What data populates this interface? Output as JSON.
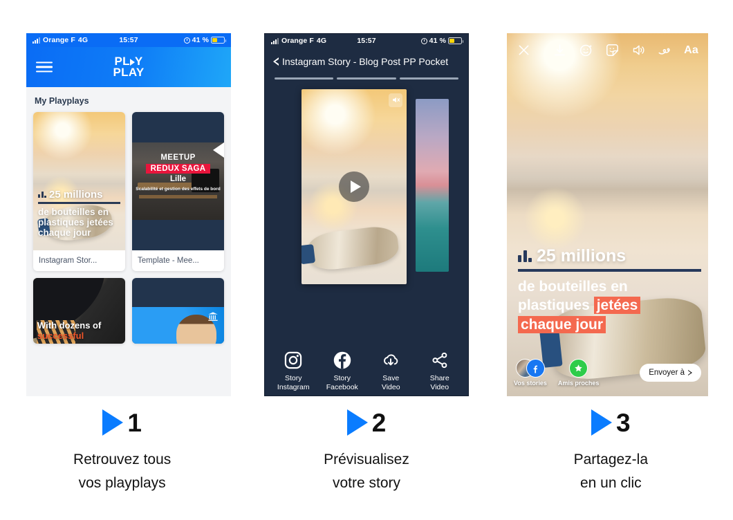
{
  "status_bar": {
    "carrier": "Orange F",
    "network": "4G",
    "time": "15:57",
    "battery_text": "41 %",
    "battery_percent": 41,
    "signal_icon": "signal-bars-icon",
    "alarm_icon": "alarm-clock-icon",
    "battery_icon": "battery-icon"
  },
  "phone1": {
    "menu_icon": "hamburger-menu-icon",
    "logo_line1": "PL",
    "logo_line1b": "Y",
    "logo_line2": "PLAY",
    "logo_play_icon": "play-triangle-icon",
    "section_title": "My Playplays",
    "cards": [
      {
        "label": "Instagram Stor...",
        "overlay_head": "25 millions",
        "overlay_sub": "de bouteilles en plastiques jetées chaque jour",
        "chart_icon": "bar-chart-icon"
      },
      {
        "label": "Template - Mee...",
        "t1": "MEETUP",
        "t2": "REDUX SAGA",
        "t3": "Lille",
        "t4": "Scalabilité et gestion des effets de bord"
      },
      {
        "overlay_l1": "With dozens of",
        "overlay_l2": "successful"
      },
      {
        "badge_icon": "unesco-bank-icon"
      }
    ]
  },
  "phone2": {
    "back_icon": "chevron-left-icon",
    "title": "Instagram Story - Blog Post PP Pocket",
    "segments": 3,
    "mute_icon": "speaker-muted-icon",
    "play_icon": "play-button-icon",
    "actions": [
      {
        "icon": "instagram-icon",
        "line1": "Story",
        "line2": "Instagram"
      },
      {
        "icon": "facebook-icon",
        "line1": "Story",
        "line2": "Facebook"
      },
      {
        "icon": "cloud-download-icon",
        "line1": "Save",
        "line2": "Video"
      },
      {
        "icon": "share-nodes-icon",
        "line1": "Share",
        "line2": "Video"
      }
    ]
  },
  "phone3": {
    "toolbar": [
      {
        "icon": "close-x-icon",
        "label": ""
      },
      {
        "icon": "download-icon",
        "label": ""
      },
      {
        "icon": "smiley-sparkle-icon",
        "label": ""
      },
      {
        "icon": "sticker-icon",
        "label": ""
      },
      {
        "icon": "volume-icon",
        "label": ""
      },
      {
        "icon": "squiggle-draw-icon",
        "label": ""
      },
      {
        "icon": "text-aa-icon",
        "label": "Aa"
      }
    ],
    "overlay_head": "25 millions",
    "overlay_line1": "de bouteilles en",
    "overlay_line2a": "plastiques ",
    "overlay_line2b": "jetées",
    "overlay_line3": "chaque jour",
    "chart_icon": "bar-chart-icon",
    "share_targets": [
      {
        "label": "Vos stories",
        "icon": "avatar-facebook-icon"
      },
      {
        "label": "Amis proches",
        "icon": "close-friends-star-icon"
      }
    ],
    "send_button": "Envoyer à",
    "send_chevron_icon": "chevron-right-icon"
  },
  "captions": [
    {
      "number": "1",
      "play_icon": "play-triangle-icon",
      "line1": "Retrouvez tous",
      "line2": "vos playplays"
    },
    {
      "number": "2",
      "play_icon": "play-triangle-icon",
      "line1": "Prévisualisez",
      "line2": "votre story"
    },
    {
      "number": "3",
      "play_icon": "play-triangle-icon",
      "line1": "Partagez-la",
      "line2": "en un clic"
    }
  ],
  "colors": {
    "brand_blue": "#0a6cf5",
    "accent_blue": "#0a7cff",
    "dark_navy": "#1e2c42",
    "coral": "#f4694f",
    "red_badge": "#e8153c"
  }
}
